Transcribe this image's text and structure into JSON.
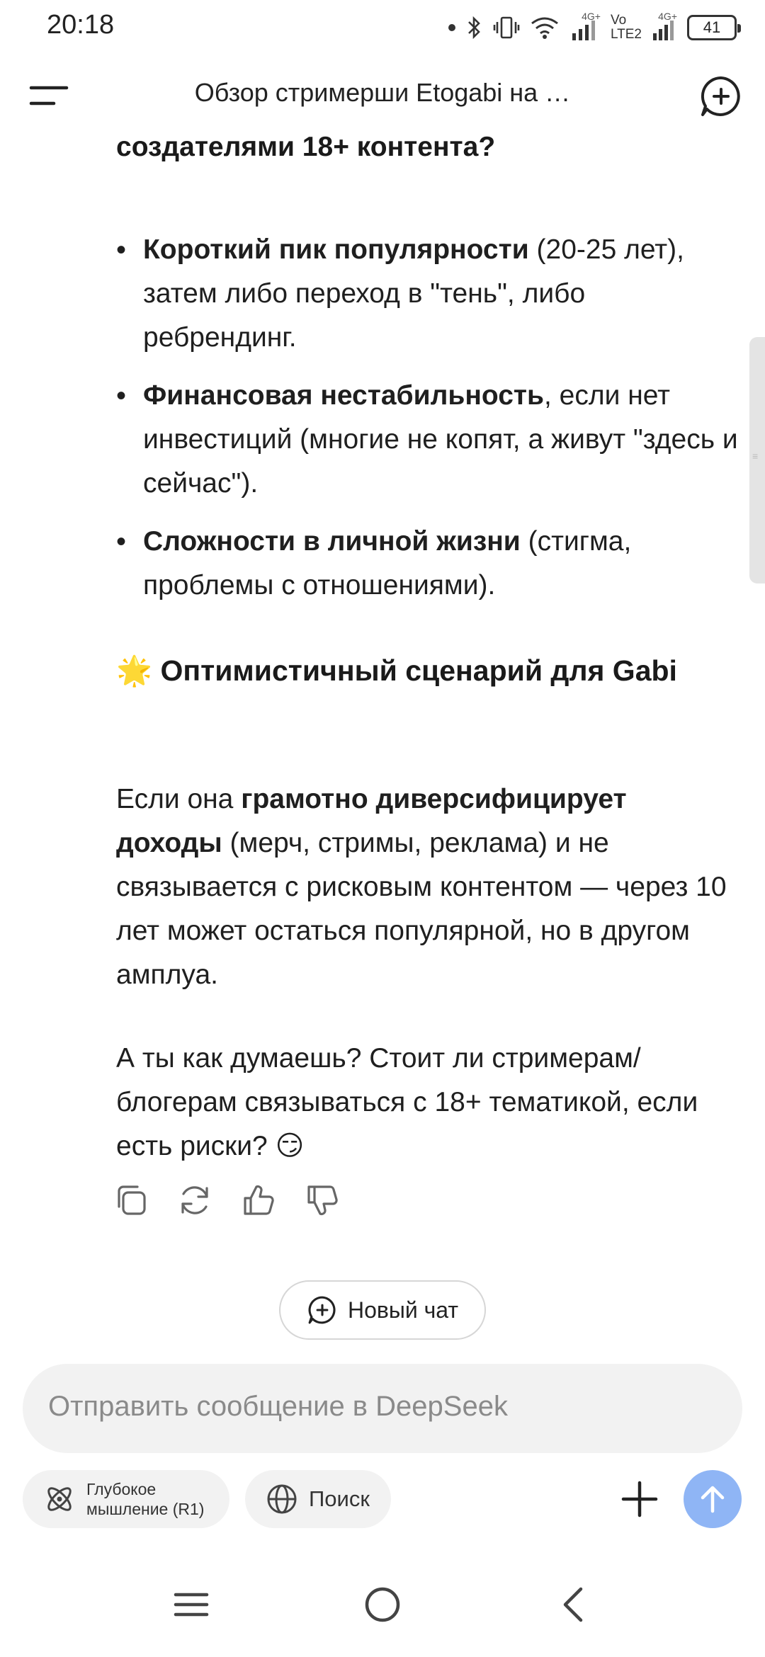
{
  "status_bar": {
    "time": "20:18",
    "network_top": "4G+",
    "vo_label": "Vo",
    "lte_label": "LTE2",
    "network_top_2": "4G+",
    "battery": "41"
  },
  "header": {
    "title": "Обзор стримерши Etogabi на …",
    "menu_icon": "menu-icon",
    "new_chat_icon": "add-chat-icon"
  },
  "message": {
    "heading_partial": "создателями 18+ контента?",
    "bullets": [
      {
        "bold": "Короткий пик популярности",
        "rest": " (20-25 лет), затем либо переход в \"тень\", либо ребрендинг."
      },
      {
        "bold": "Финансовая нестабильность",
        "rest": ", если нет инвестиций (многие не копят, а живут \"здесь и сейчас\")."
      },
      {
        "bold": "Сложности в личной жизни",
        "rest": " (стигма, проблемы с отношениями)."
      }
    ],
    "section_emoji": "🌟",
    "section_heading": "Оптимистичный сценарий для Gabi",
    "para1_start": "Если она ",
    "para1_bold": "грамотно диверсифицирует доходы",
    "para1_rest": " (мерч, стримы, реклама) и не связывается с рисковым контентом — через 10 лет может остаться популярной, но в другом амплуа.",
    "para2": "А ты как думаешь? Стоит ли стримерам/блогерам связываться с 18+ тематикой, если есть риски?",
    "para2_emoji": "😏"
  },
  "actions": [
    "copy-icon",
    "regenerate-icon",
    "thumbs-up-icon",
    "thumbs-down-icon"
  ],
  "new_chat_button": "Новый чат",
  "composer": {
    "placeholder": "Отправить сообщение в DeepSeek",
    "deep_think_label": "Глубокое мышление (R1)",
    "search_label": "Поиск"
  },
  "colors": {
    "send_button": "#8fb5f5",
    "pill_bg": "#f2f2f2"
  }
}
